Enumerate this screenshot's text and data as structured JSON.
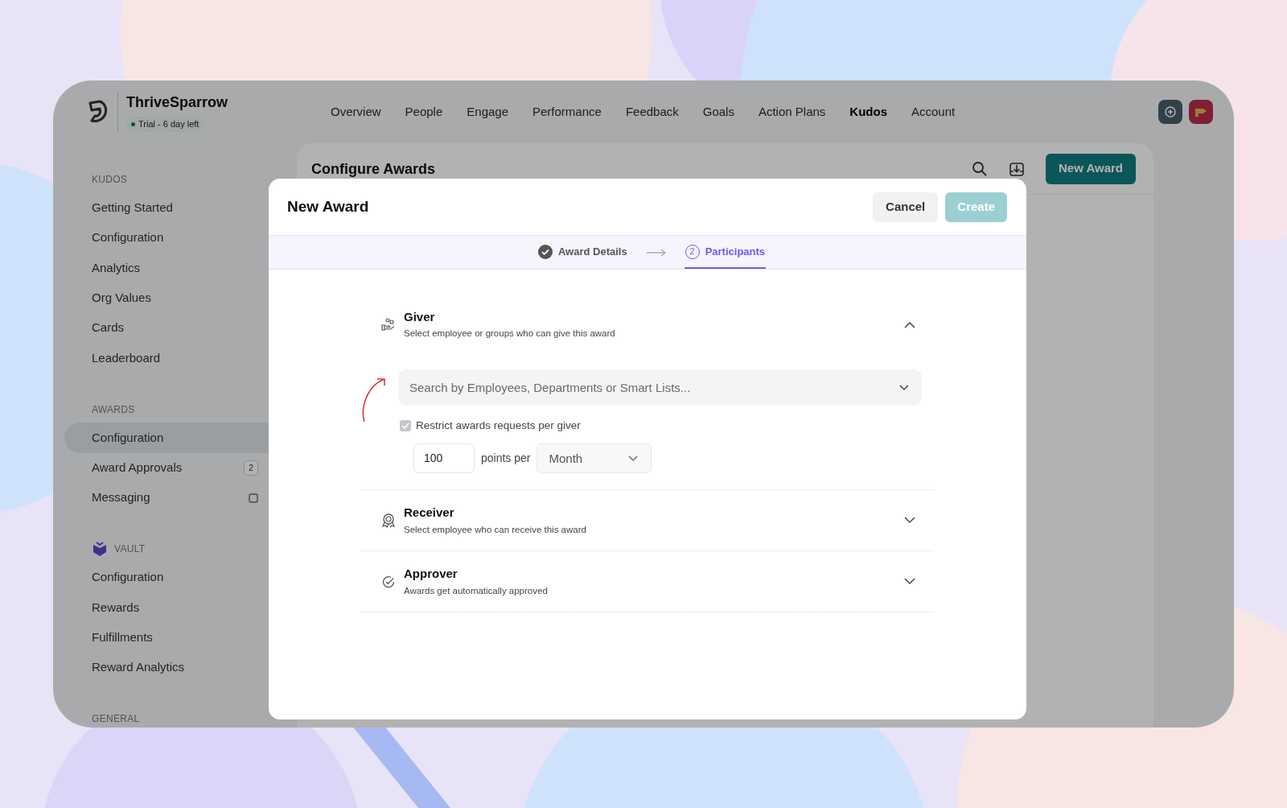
{
  "brand": {
    "name": "ThriveSparrow",
    "trial_badge": "Trial - 6 day left"
  },
  "nav": [
    {
      "label": "Overview",
      "selected": false
    },
    {
      "label": "People",
      "selected": false
    },
    {
      "label": "Engage",
      "selected": false
    },
    {
      "label": "Performance",
      "selected": false
    },
    {
      "label": "Feedback",
      "selected": false
    },
    {
      "label": "Goals",
      "selected": false
    },
    {
      "label": "Action Plans",
      "selected": false
    },
    {
      "label": "Kudos",
      "selected": true
    },
    {
      "label": "Account",
      "selected": false
    }
  ],
  "sidebar": [
    {
      "heading": "KUDOS",
      "kind": "plain",
      "items": [
        {
          "label": "Getting Started",
          "kind": "link",
          "selected": false
        },
        {
          "label": "Configuration",
          "kind": "link",
          "selected": false
        },
        {
          "label": "Analytics",
          "kind": "link",
          "selected": false
        },
        {
          "label": "Org Values",
          "kind": "link",
          "selected": false
        },
        {
          "label": "Cards",
          "kind": "link",
          "selected": false
        },
        {
          "label": "Leaderboard",
          "kind": "link",
          "selected": false
        }
      ]
    },
    {
      "heading": "AWARDS",
      "kind": "plain",
      "items": [
        {
          "label": "Configuration",
          "kind": "link",
          "selected": true
        },
        {
          "label": "Award Approvals",
          "kind": "badge",
          "badge": "2",
          "selected": false
        },
        {
          "label": "Messaging",
          "kind": "icon",
          "selected": false
        }
      ]
    },
    {
      "heading": "VAULT",
      "kind": "vault",
      "items": [
        {
          "label": "Configuration",
          "kind": "link",
          "selected": false
        },
        {
          "label": "Rewards",
          "kind": "link",
          "selected": false
        },
        {
          "label": "Fulfillments",
          "kind": "link",
          "selected": false
        },
        {
          "label": "Reward Analytics",
          "kind": "link",
          "selected": false
        }
      ]
    },
    {
      "heading": "GENERAL",
      "kind": "plain"
    }
  ],
  "page": {
    "title": "Configure Awards",
    "primary_button": "New Award"
  },
  "modal": {
    "title": "New Award",
    "cancel": "Cancel",
    "create": {
      "label": "Create",
      "disabled": true
    },
    "steps": [
      {
        "label": "Award Details",
        "done": true,
        "selected": false
      },
      {
        "label": "Participants",
        "number": "2",
        "done": false,
        "selected": true
      }
    ],
    "sections": [
      {
        "kind": "giver",
        "title": "Giver",
        "subtitle": "Select employee or groups who can give this award",
        "expanded": true
      },
      {
        "kind": "receiver",
        "title": "Receiver",
        "subtitle": "Select employee who can receive this award",
        "expanded": false
      },
      {
        "kind": "approver",
        "title": "Approver",
        "subtitle": "Awards get automatically approved",
        "expanded": false
      }
    ],
    "giver": {
      "placeholder": "Search by Employees, Departments or Smart Lists...",
      "restrict": {
        "label": "Restrict awards requests per giver",
        "checked": true,
        "disabled": true
      },
      "points": "100",
      "points_label": "points per",
      "period": "Month"
    }
  }
}
